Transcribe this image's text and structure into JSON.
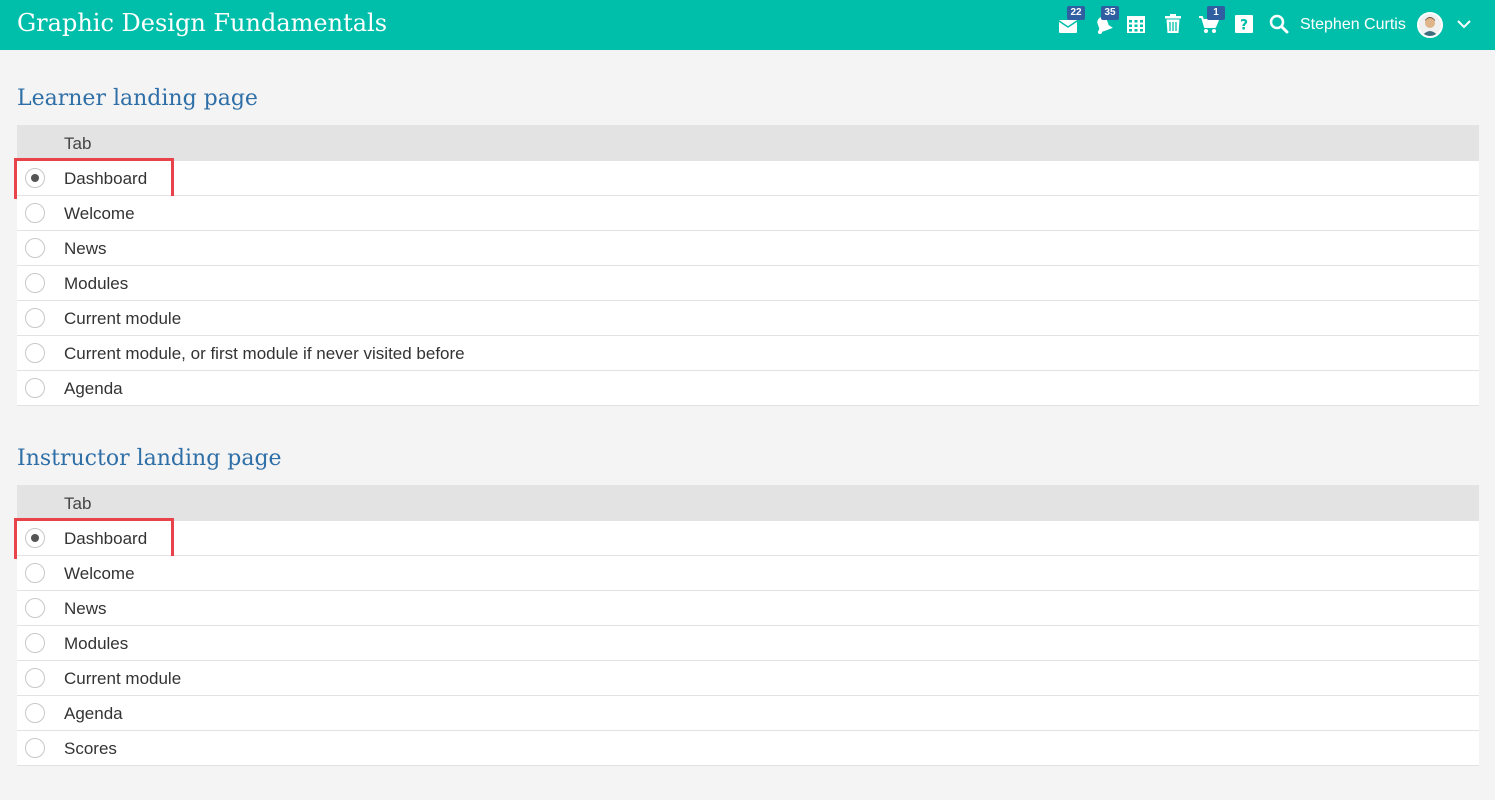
{
  "header": {
    "title": "Graphic Design Fundamentals",
    "user_name": "Stephen Curtis",
    "icons": [
      {
        "name": "messages-icon",
        "badge": "22"
      },
      {
        "name": "notifications-icon",
        "badge": "35"
      },
      {
        "name": "calendar-icon",
        "badge": ""
      },
      {
        "name": "trash-icon",
        "badge": ""
      },
      {
        "name": "cart-icon",
        "badge": "1"
      },
      {
        "name": "help-icon",
        "badge": ""
      },
      {
        "name": "search-icon",
        "badge": ""
      }
    ],
    "colors": {
      "bar": "#00bfaa",
      "badge": "#2f5fa0"
    }
  },
  "learner": {
    "title": "Learner landing page",
    "column": "Tab",
    "selected": "Dashboard",
    "options": [
      "Dashboard",
      "Welcome",
      "News",
      "Modules",
      "Current module",
      "Current module, or first module if never visited before",
      "Agenda"
    ]
  },
  "instructor": {
    "title": "Instructor landing page",
    "column": "Tab",
    "selected": "Dashboard",
    "options": [
      "Dashboard",
      "Welcome",
      "News",
      "Modules",
      "Current module",
      "Agenda",
      "Scores"
    ]
  }
}
